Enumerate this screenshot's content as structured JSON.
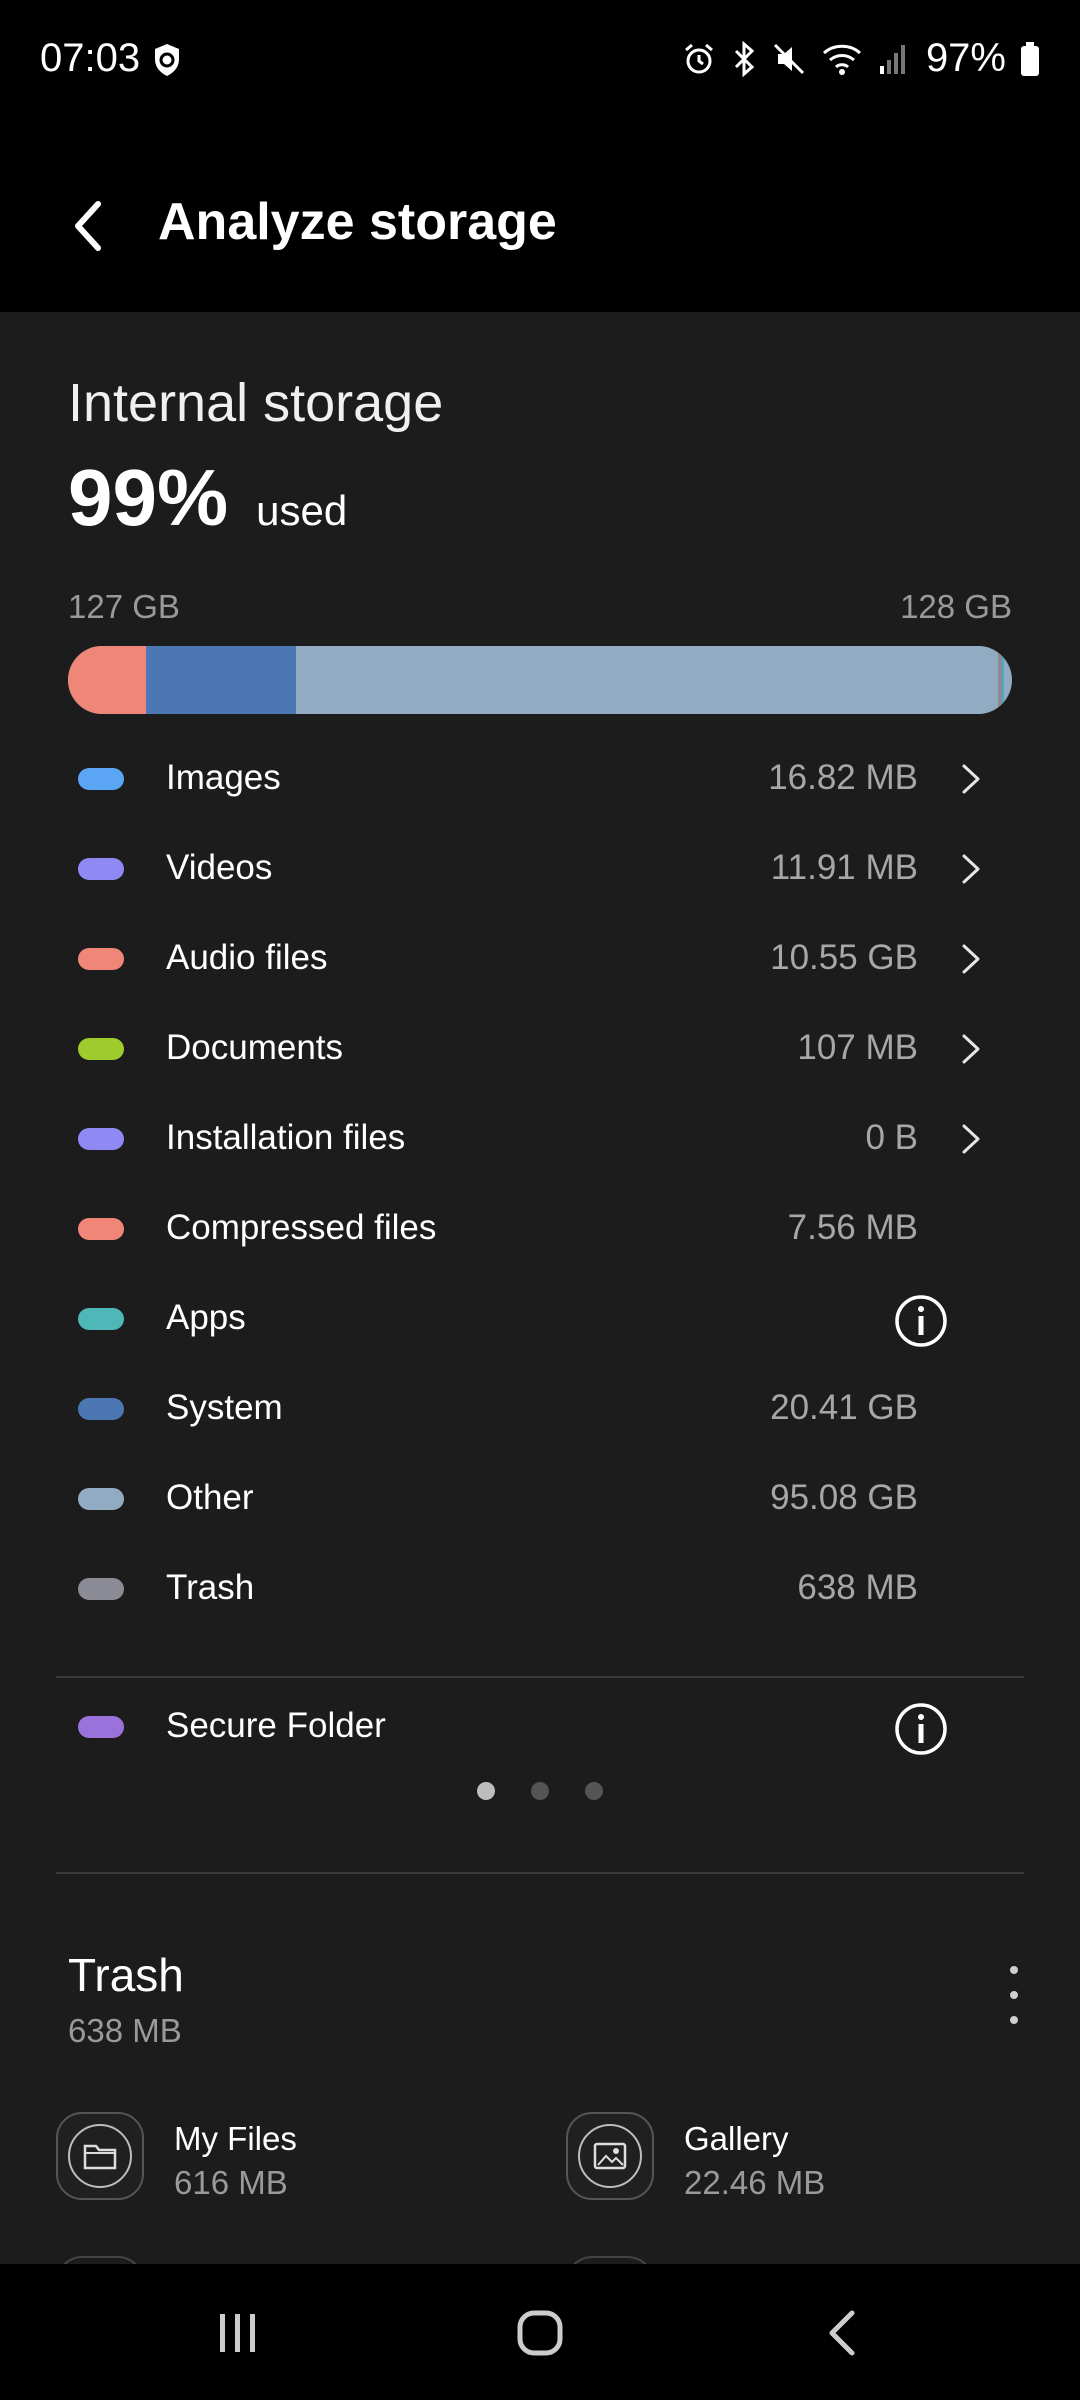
{
  "status_bar": {
    "time": "07:03",
    "battery": "97%",
    "icons": [
      "shield-icon",
      "alarm-icon",
      "bluetooth-icon",
      "mute-icon",
      "wifi-icon",
      "signal-icon",
      "battery-icon"
    ]
  },
  "app_bar": {
    "back_icon": "back-arrow-icon",
    "title": "Analyze storage"
  },
  "storage": {
    "title": "Internal storage",
    "percent": "99%",
    "used_word": "used",
    "used_gb": "127 GB",
    "total_gb": "128 GB",
    "usage_fraction": 0.99,
    "bar_segments": [
      {
        "name": "Audio files",
        "value_gb": 10.55,
        "color": "#ef8677"
      },
      {
        "name": "System",
        "value_gb": 20.41,
        "color": "#4b78b2"
      },
      {
        "name": "Other",
        "value_gb": 95.08,
        "color": "#91acc2"
      },
      {
        "name": "Trash",
        "value_gb": 0.638,
        "color": "#8b8b95"
      },
      {
        "name": "Apps",
        "value_gb": 0.3,
        "color": "#4eaac1"
      }
    ]
  },
  "categories": [
    {
      "label": "Images",
      "size": "16.82 MB",
      "color": "#5aa6f5",
      "action": "chevron"
    },
    {
      "label": "Videos",
      "size": "11.91 MB",
      "color": "#8f89f5",
      "action": "chevron"
    },
    {
      "label": "Audio files",
      "size": "10.55 GB",
      "color": "#ef8677",
      "action": "chevron"
    },
    {
      "label": "Documents",
      "size": "107 MB",
      "color": "#9dcc2c",
      "action": "chevron"
    },
    {
      "label": "Installation files",
      "size": "0 B",
      "color": "#8f89f5",
      "action": "chevron"
    },
    {
      "label": "Compressed files",
      "size": "7.56 MB",
      "color": "#ef8677",
      "action": "none"
    },
    {
      "label": "Apps",
      "size": "",
      "color": "#4db8b7",
      "action": "info"
    },
    {
      "label": "System",
      "size": "20.41 GB",
      "color": "#4b78b2",
      "action": "none"
    },
    {
      "label": "Other",
      "size": "95.08 GB",
      "color": "#91acc2",
      "action": "none"
    },
    {
      "label": "Trash",
      "size": "638 MB",
      "color": "#8b8b95",
      "action": "none"
    }
  ],
  "secure_folder": {
    "label": "Secure Folder",
    "color": "#9b72dc",
    "action": "info"
  },
  "page_indicator": {
    "count": 3,
    "active": 1
  },
  "trash": {
    "title": "Trash",
    "size": "638 MB",
    "items": [
      {
        "name": "My Files",
        "size": "616 MB",
        "icon": "folder-icon"
      },
      {
        "name": "Gallery",
        "size": "22.46 MB",
        "icon": "gallery-icon"
      }
    ]
  },
  "nav_bar": {
    "icons": [
      "recents-icon",
      "home-icon",
      "back-nav-icon"
    ]
  }
}
